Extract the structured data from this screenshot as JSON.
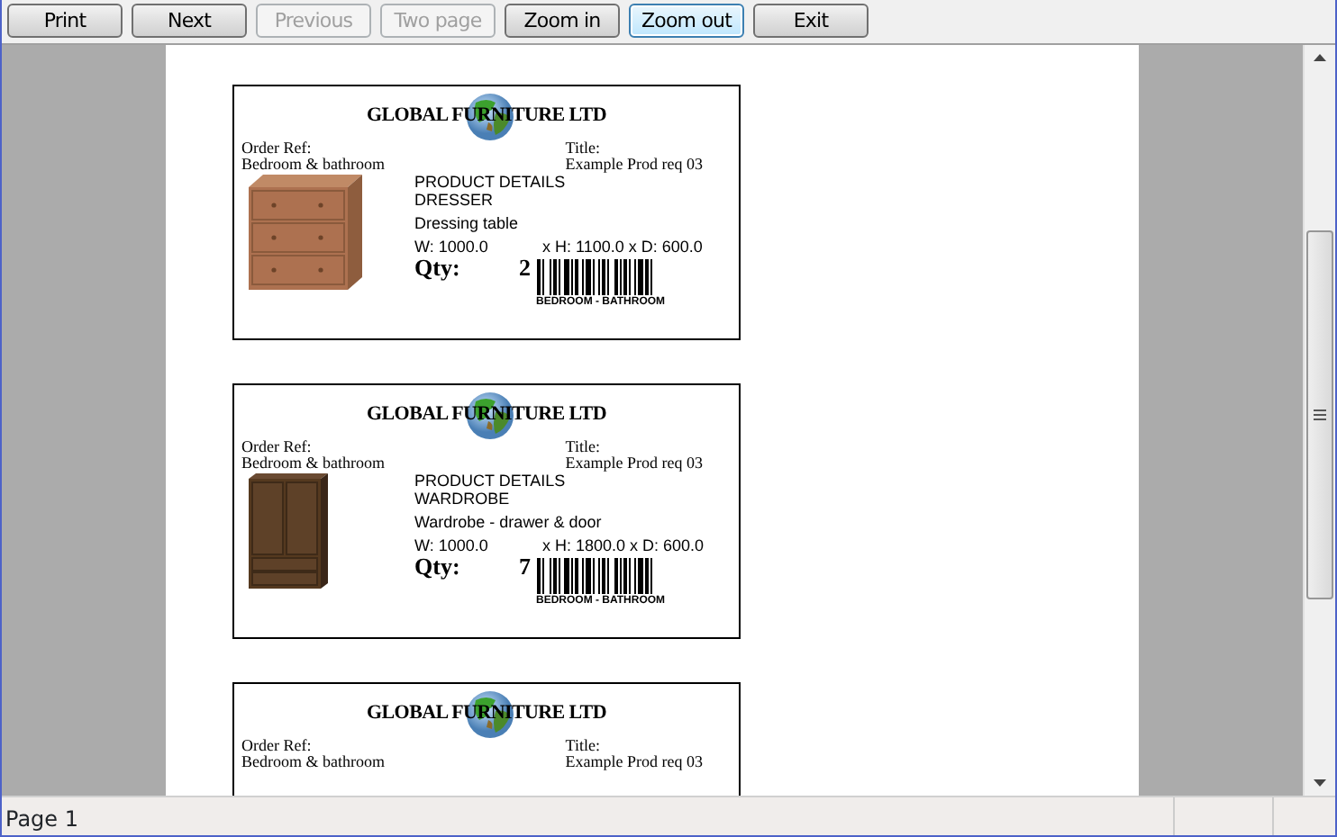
{
  "toolbar": [
    {
      "label": "Print",
      "disabled": false,
      "focused": false
    },
    {
      "label": "Next",
      "disabled": false,
      "focused": false
    },
    {
      "label": "Previous",
      "disabled": true,
      "focused": false
    },
    {
      "label": "Two page",
      "disabled": true,
      "focused": false
    },
    {
      "label": "Zoom in",
      "disabled": false,
      "focused": false
    },
    {
      "label": "Zoom out",
      "disabled": false,
      "focused": true
    },
    {
      "label": "Exit",
      "disabled": false,
      "focused": false
    }
  ],
  "labels": [
    {
      "company": "GLOBAL FURNITURE LTD",
      "order_ref_label": "Order Ref:",
      "order_ref": "Bedroom & bathroom",
      "title_label": "Title:",
      "title": "Example Prod req 03",
      "item": {
        "kind": "dresser",
        "heading": "PRODUCT DETAILS",
        "name": "DRESSER",
        "description": "Dressing table",
        "width": "W: 1000.0",
        "size": "x H: 1100.0 x D: 600.0",
        "qty_label": "Qty:",
        "qty": "2",
        "barcode_text": "BEDROOM - BATHROOM"
      }
    },
    {
      "company": "GLOBAL FURNITURE LTD",
      "order_ref_label": "Order Ref:",
      "order_ref": "Bedroom & bathroom",
      "title_label": "Title:",
      "title": "Example Prod req 03",
      "item": {
        "kind": "wardrobe",
        "heading": "PRODUCT DETAILS",
        "name": "WARDROBE",
        "description": "Wardrobe - drawer & door",
        "width": "W: 1000.0",
        "size": "x H: 1800.0 x D: 600.0",
        "qty_label": "Qty:",
        "qty": "7",
        "barcode_text": "BEDROOM - BATHROOM"
      }
    },
    {
      "company": "GLOBAL FURNITURE LTD",
      "order_ref_label": "Order Ref:",
      "order_ref": "Bedroom & bathroom",
      "title_label": "Title:",
      "title": "Example Prod req 03"
    }
  ],
  "status_bar": {
    "page": "Page 1"
  }
}
